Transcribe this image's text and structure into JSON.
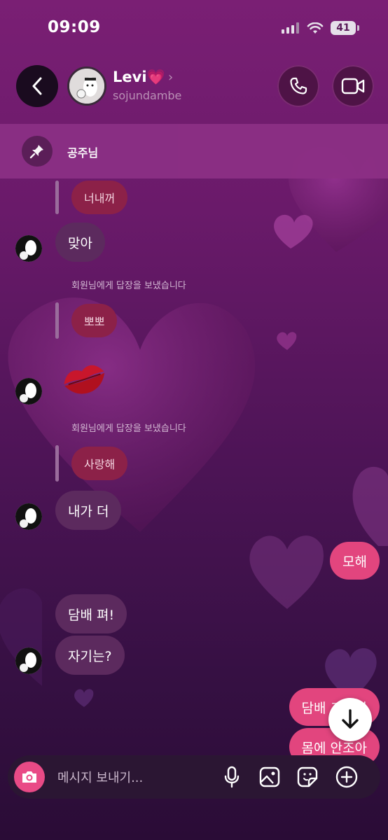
{
  "status": {
    "time": "09:09",
    "battery": "41"
  },
  "header": {
    "name": "Levi💗",
    "username": "sojundambe"
  },
  "pinned": {
    "label": "공주님"
  },
  "messages": {
    "reply1": "너내꺼",
    "in1": "맞아",
    "reply_note": "회원님에게 답장을 보냈습니다",
    "reply2": "뽀뽀",
    "reply3": "사랑해",
    "in2": "내가 더",
    "out1": "모해",
    "in3": "담배 펴!",
    "in4": "자기는?",
    "out2": "담배 그만피",
    "out3": "몸에 안조아"
  },
  "composer": {
    "placeholder": "메시지 보내기..."
  },
  "colors": {
    "bubble_out": "#e2457e",
    "bubble_in": "#5c2a5e",
    "reply_bubble": "#8c2148",
    "accent": "#e94a86"
  },
  "icons": [
    "back-icon",
    "phone-icon",
    "video-icon",
    "pin-icon",
    "camera-icon",
    "mic-icon",
    "image-icon",
    "sticker-icon",
    "plus-icon",
    "arrow-down-icon",
    "kiss-icon"
  ]
}
